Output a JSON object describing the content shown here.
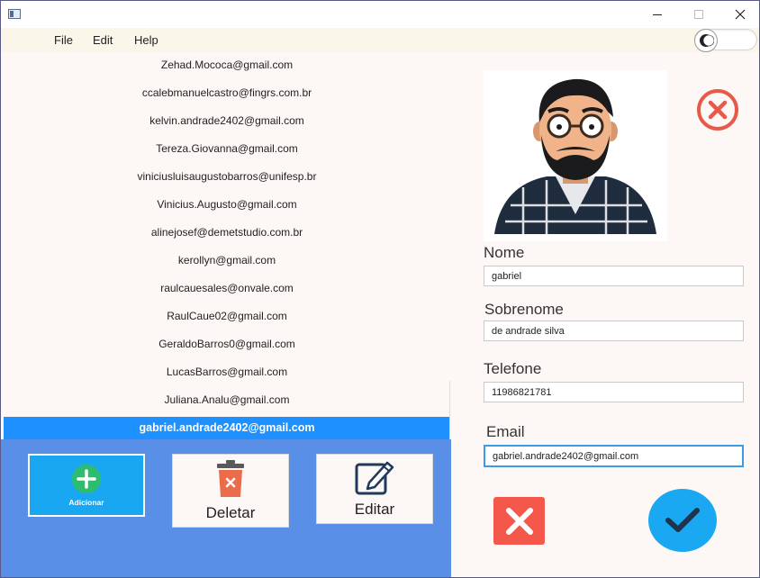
{
  "menu": {
    "file": "File",
    "edit": "Edit",
    "help": "Help"
  },
  "emails": [
    "Zehad.Mococa@gmail.com",
    "ccalebmanuelcastro@fingrs.com.br",
    "kelvin.andrade2402@gmail.com",
    "Tereza.Giovanna@gmail.com",
    "viniciusluisaugustobarros@unifesp.br",
    "Vinicius.Augusto@gmail.com",
    "alinejosef@demetstudio.com.br",
    "kerollyn@gmail.com",
    "raulcauesales@onvale.com",
    "RaulCaue02@gmail.com",
    "GeraldoBarros0@gmail.com",
    "LucasBarros@gmail.com",
    "Juliana.Analu@gmail.com",
    "gabriel.andrade2402@gmail.com"
  ],
  "selected_email": "gabriel.andrade2402@gmail.com",
  "actions": {
    "add": "Adicionar",
    "delete": "Deletar",
    "edit": "Editar"
  },
  "form": {
    "nome_label": "Nome",
    "nome_value": "gabriel",
    "sobrenome_label": "Sobrenome",
    "sobrenome_value": "de andrade silva",
    "telefone_label": "Telefone",
    "telefone_value": "11986821781",
    "email_label": "Email",
    "email_value": "gabriel.andrade2402@gmail.com"
  },
  "colors": {
    "selection": "#1e90ff",
    "actions_panel": "#5a8fe8",
    "cancel": "#f4584a",
    "confirm": "#1ba8f2",
    "remove_photo": "#e9594a"
  },
  "icons": {
    "add": "plus-circle-icon",
    "delete": "trash-icon",
    "edit": "pencil-square-icon",
    "remove_photo": "circle-x-icon",
    "cancel": "x-icon",
    "confirm": "check-icon",
    "theme_toggle": "moon-icon"
  }
}
